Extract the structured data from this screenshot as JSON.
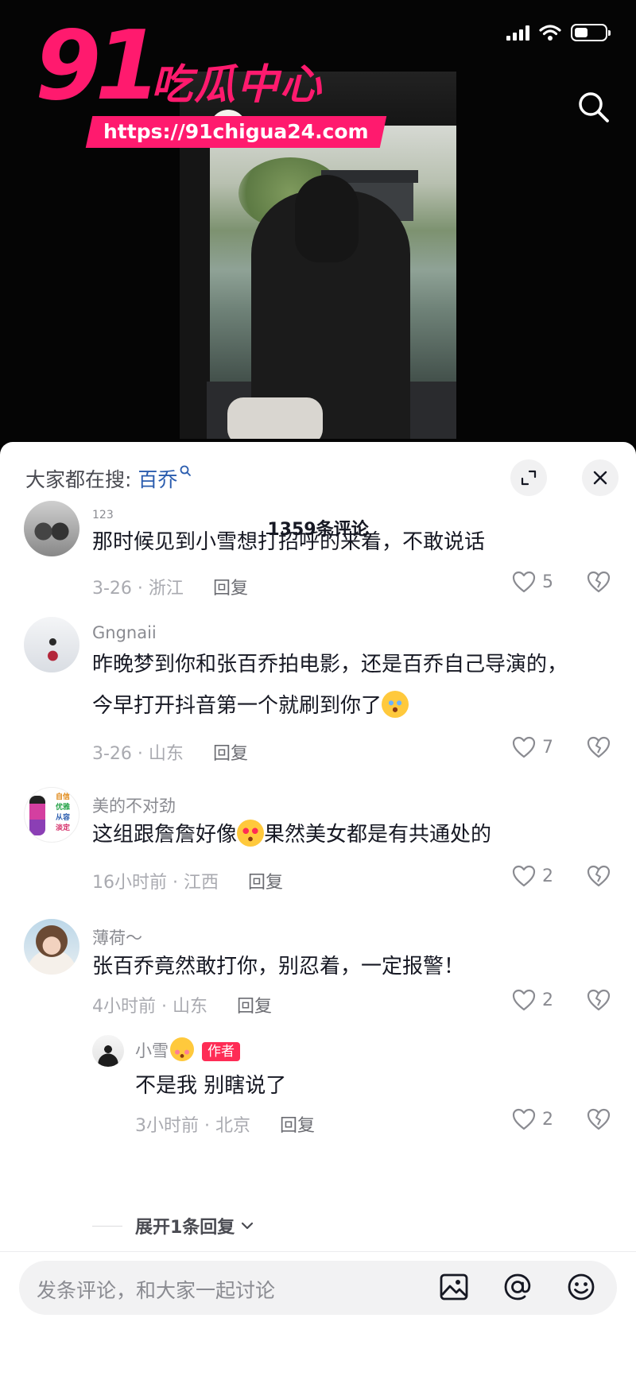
{
  "watermark": {
    "number": "91",
    "site_name": "吃瓜中心",
    "url": "https://91chigua24.com"
  },
  "sheet": {
    "hot_search_prefix": "大家都在搜:",
    "hot_search_keyword": "百乔",
    "comment_count": "1359条评论"
  },
  "comments": [
    {
      "username": "123",
      "text": "那时候见到小雪想打招呼的来着，不敢说话",
      "time": "3-26",
      "location": "浙江",
      "reply_label": "回复",
      "likes": "5"
    },
    {
      "username": "Gngnaii",
      "text_line1": "昨晚梦到你和张百乔拍电影，还是百乔自己导演的，",
      "text_line2": "今早打开抖音第一个就刷到你了",
      "time": "3-26",
      "location": "山东",
      "reply_label": "回复",
      "likes": "7"
    },
    {
      "username": "美的不对劲",
      "text_a": "这组跟詹詹好像",
      "text_b": "果然美女都是有共通处的",
      "avatar_text": [
        "自信",
        "优雅",
        "从容",
        "淡定"
      ],
      "time": "16小时前",
      "location": "江西",
      "reply_label": "回复",
      "likes": "2"
    },
    {
      "username": "薄荷～",
      "text": "张百乔竟然敢打你，别忍着，一定报警！",
      "time": "4小时前",
      "location": "山东",
      "reply_label": "回复",
      "likes": "2"
    }
  ],
  "reply": {
    "username": "小雪",
    "author_tag": "作者",
    "text": "不是我 别瞎说了",
    "time": "3小时前",
    "location": "北京",
    "reply_label": "回复",
    "likes": "2"
  },
  "expand_more": "展开1条回复",
  "input": {
    "placeholder": "发条评论，和大家一起讨论"
  },
  "colors": {
    "brand_pink": "#ff1a6e",
    "author_red": "#fe2c55",
    "link_blue": "#2a5cae"
  },
  "icons": [
    "search-icon",
    "expand-icon",
    "close-icon",
    "heart-icon",
    "broken-heart-icon",
    "image-icon",
    "at-icon",
    "emoji-icon"
  ]
}
